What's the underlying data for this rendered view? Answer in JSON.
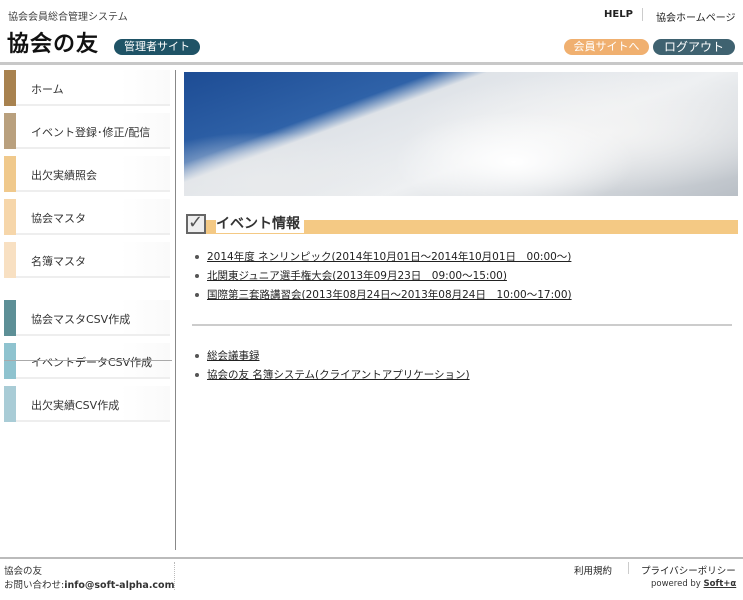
{
  "header": {
    "system_name": "協会会員総合管理システム",
    "logo": "協会の友",
    "admin_badge": "管理者サイト",
    "help": "HELP",
    "homepage": "協会ホームページ",
    "member_site": "会員サイトへ",
    "logout": "ログアウト"
  },
  "sidebar": {
    "items": [
      {
        "label": "ホーム",
        "color": "#a8824f"
      },
      {
        "label": "イベント登録･修正/配信",
        "color": "#b9a07e"
      },
      {
        "label": "出欠実績照会",
        "color": "#f0c98c"
      },
      {
        "label": "協会マスタ",
        "color": "#f6d6aa"
      },
      {
        "label": "名簿マスタ",
        "color": "#f8e0c2"
      }
    ],
    "csv_items": [
      {
        "label": "協会マスタCSV作成",
        "color": "#5d8f96"
      },
      {
        "label": "イベントデータCSV作成",
        "color": "#8fc3cf"
      },
      {
        "label": "出欠実績CSV作成",
        "color": "#a9ccd6"
      }
    ]
  },
  "main": {
    "section_title": "イベント情報",
    "events": [
      "2014年度 ネンリンピック(2014年10月01日～2014年10月01日　00:00～)",
      "北関東ジュニア選手権大会(2013年09月23日　09:00～15:00)",
      "国際第三套路講習会(2013年08月24日～2013年08月24日　10:00～17:00)"
    ],
    "docs": [
      "総会議事録",
      "協会の友 名簿システム(クライアントアプリケーション)"
    ]
  },
  "footer": {
    "org": "協会の友",
    "contact_label": "お問い合わせ:",
    "contact_email": "info@soft-alpha.com",
    "terms": "利用規約",
    "privacy": "プライバシーポリシー",
    "powered_by": "powered by",
    "brand": "Soft+α"
  }
}
